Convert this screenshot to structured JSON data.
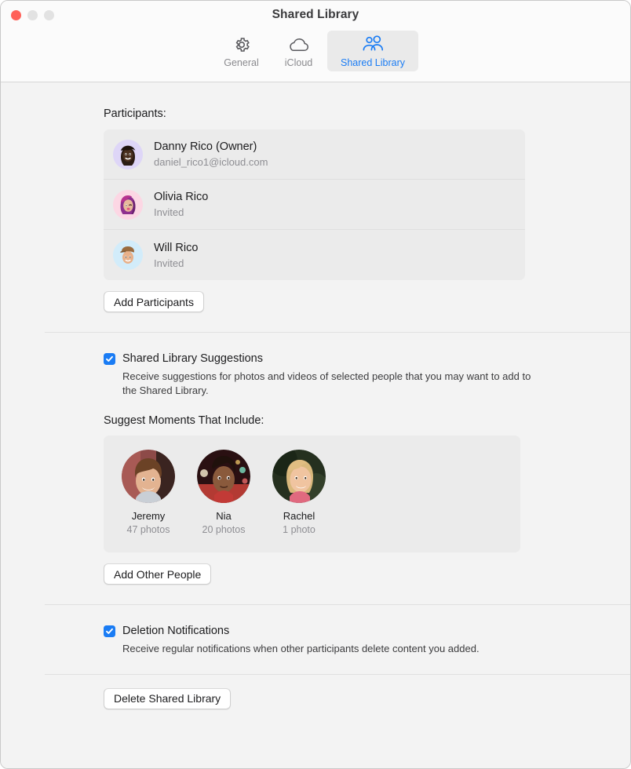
{
  "window": {
    "title": "Shared Library",
    "traffic_lights": [
      "close",
      "minimize",
      "maximize"
    ]
  },
  "toolbar": {
    "tabs": [
      {
        "label": "General",
        "icon": "gear-icon",
        "selected": false
      },
      {
        "label": "iCloud",
        "icon": "cloud-icon",
        "selected": false
      },
      {
        "label": "Shared Library",
        "icon": "two-people-icon",
        "selected": true
      }
    ],
    "accent_color": "#1a7cf4",
    "inactive_color": "#8a8a8e"
  },
  "participants": {
    "label": "Participants:",
    "rows": [
      {
        "name": "Danny Rico (Owner)",
        "detail": "daniel_rico1@icloud.com",
        "avatar_bg": "#ded6f7"
      },
      {
        "name": "Olivia Rico",
        "detail": "Invited",
        "avatar_bg": "#fcd7e4"
      },
      {
        "name": "Will Rico",
        "detail": "Invited",
        "avatar_bg": "#d2ecfa"
      }
    ],
    "add_button": "Add Participants"
  },
  "suggestions": {
    "checkbox_label": "Shared Library Suggestions",
    "checked": true,
    "description": "Receive suggestions for photos and videos of selected people that you may want to add to the Shared Library.",
    "moments_label": "Suggest Moments That Include:",
    "people": [
      {
        "name": "Jeremy",
        "count": "47 photos"
      },
      {
        "name": "Nia",
        "count": "20 photos"
      },
      {
        "name": "Rachel",
        "count": "1 photo"
      }
    ],
    "add_button": "Add Other People"
  },
  "deletion": {
    "checkbox_label": "Deletion Notifications",
    "checked": true,
    "description": "Receive regular notifications when other participants delete content you added."
  },
  "footer": {
    "delete_button": "Delete Shared Library"
  }
}
